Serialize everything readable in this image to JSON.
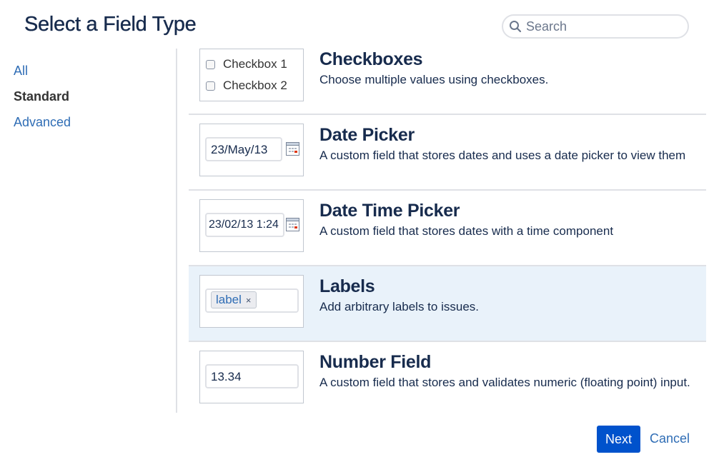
{
  "dialog": {
    "title": "Select a Field Type"
  },
  "search": {
    "placeholder": "Search",
    "icon": "search-icon"
  },
  "sidebar": {
    "items": [
      {
        "label": "All",
        "active": false
      },
      {
        "label": "Standard",
        "active": true
      },
      {
        "label": "Advanced",
        "active": false
      }
    ]
  },
  "fields": [
    {
      "name": "Checkboxes",
      "description": "Choose multiple values using checkboxes.",
      "preview": {
        "checkbox_1": "Checkbox 1",
        "checkbox_2": "Checkbox 2"
      }
    },
    {
      "name": "Date Picker",
      "description": "A custom field that stores dates and uses a date picker to view them",
      "preview": {
        "value": "23/May/13",
        "icon": "calendar-icon"
      }
    },
    {
      "name": "Date Time Picker",
      "description": "A custom field that stores dates with a time component",
      "preview": {
        "value": "23/02/13 1:24",
        "icon": "calendar-icon"
      }
    },
    {
      "name": "Labels",
      "description": "Add arbitrary labels to issues.",
      "selected": true,
      "preview": {
        "label": "label",
        "remove": "×"
      }
    },
    {
      "name": "Number Field",
      "description": "A custom field that stores and validates numeric (floating point) input.",
      "preview": {
        "value": "13.34"
      }
    }
  ],
  "footer": {
    "next_label": "Next",
    "cancel_label": "Cancel"
  },
  "colors": {
    "primary": "#0052cc",
    "link": "#2f6db5",
    "selected_row": "#e9f2fa",
    "heading": "#172b4d"
  }
}
